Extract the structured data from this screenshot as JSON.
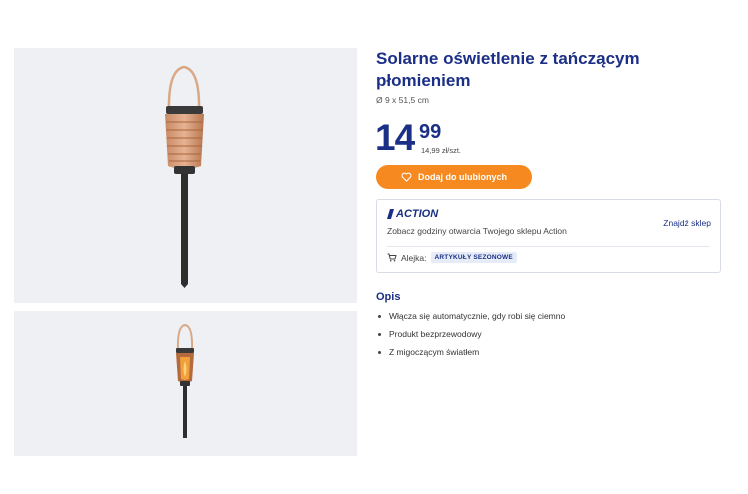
{
  "product": {
    "title": "Solarne oświetlenie z tańczącym płomieniem",
    "dimensions": "Ø 9 x 51,5 cm",
    "price_integer": "14",
    "price_decimal": "99",
    "unit_price": "14,99 zł/szt.",
    "favorite_button_label": "Dodaj do ulubionych"
  },
  "store": {
    "logo_text": "ACTION",
    "hours_text": "Zobacz godziny otwarcia Twojego sklepu Action",
    "find_store_label": "Znajdź sklep",
    "aisle_label": "Alejka:",
    "aisle_value": "ARTYKUŁY SEZONOWE"
  },
  "description": {
    "heading": "Opis",
    "bullets": [
      "Włącza się automatycznie, gdy robi się ciemno",
      "Produkt bezprzewodowy",
      "Z migoczącym światłem"
    ]
  },
  "icons": {
    "favorite": "heart-icon",
    "aisle": "cart-icon",
    "logo": "action-logo-icon"
  },
  "colors": {
    "brand_blue": "#1b2f86",
    "accent_orange": "#f6891f",
    "image_background": "#eef0f3"
  }
}
